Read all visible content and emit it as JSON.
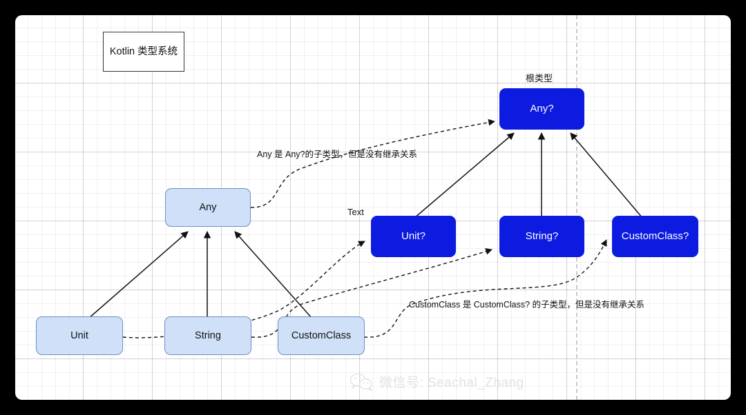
{
  "diagram": {
    "title_box": "Kotlin 类型系统",
    "root_label": "根类型",
    "text_label": "Text",
    "nodes": {
      "any_nullable": "Any?",
      "unit_nullable": "Unit?",
      "string_nullable": "String?",
      "customclass_nullable": "CustomClass?",
      "any": "Any",
      "unit": "Unit",
      "string": "String",
      "customclass": "CustomClass"
    },
    "annotations": {
      "any_note": "Any 是 Any?的子类型，但是没有继承关系",
      "customclass_note": "CustomClass 是 CustomClass? 的子类型，但是没有继承关系"
    },
    "colors": {
      "nullable_fill": "#0d1ae0",
      "base_fill": "#cfe0f8",
      "base_border": "#6b8fc4",
      "canvas": "#ffffff",
      "backdrop": "#000000"
    }
  },
  "watermark": {
    "icon": "wechat-icon",
    "text": "微信号: Seachal_Zhang"
  }
}
